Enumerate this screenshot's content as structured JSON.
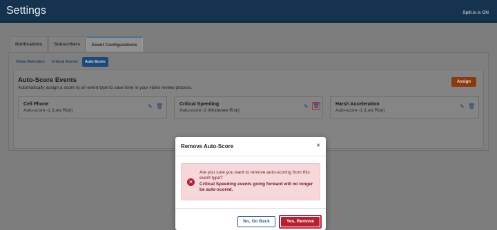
{
  "header": {
    "title": "Settings",
    "status": "Split.io is ON"
  },
  "tabs": [
    {
      "label": "Notifications"
    },
    {
      "label": "Subscribers"
    },
    {
      "label": "Event Configurations"
    }
  ],
  "subtabs": [
    {
      "label": "Video Retention"
    },
    {
      "label": "Critical Events"
    },
    {
      "label": "Auto-Score"
    }
  ],
  "section": {
    "title": "Auto-Score Events",
    "description": "Automatically assign a score to an event type to save time in your video review process.",
    "assign_label": "Assign"
  },
  "events": [
    {
      "name": "Cell Phone",
      "score": "Auto-score -1 (Low Risk)"
    },
    {
      "name": "Critical Speeding",
      "score": "Auto-score -2 (Moderate Risk)"
    },
    {
      "name": "Harsh Acceleration",
      "score": "Auto-score -1 (Low Risk)"
    }
  ],
  "modal": {
    "title": "Remove Auto-Score",
    "close": "×",
    "question": "Are you sure you want to remove auto-scoring from this event type?",
    "warning": "Critical Speeding events going forward will no longer be auto-scored.",
    "back_label": "No, Go Back",
    "remove_label": "Yes, Remove"
  },
  "colors": {
    "navy": "#15324f",
    "accent": "#b7212f",
    "assign": "#8a3a12"
  }
}
